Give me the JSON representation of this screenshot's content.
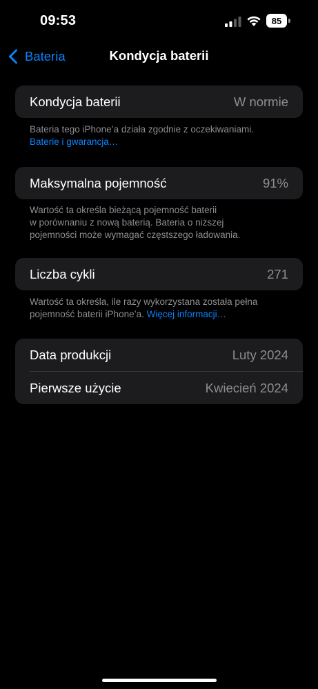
{
  "status_bar": {
    "time": "09:53",
    "battery_level": "85"
  },
  "nav": {
    "back_label": "Bateria",
    "title": "Kondycja baterii"
  },
  "health": {
    "label": "Kondycja baterii",
    "value": "W normie",
    "footnote": "Bateria tego iPhone’a działa zgodnie z oczekiwaniami.",
    "link": "Baterie i gwarancja…"
  },
  "capacity": {
    "label": "Maksymalna pojemność",
    "value": "91%",
    "footnote_line1": "Wartość ta określa bieżącą pojemność baterii",
    "footnote_line2": "w porównaniu z nową baterią. Bateria o niższej",
    "footnote_line3": "pojemności może wymagać częstszego ładowania."
  },
  "cycles": {
    "label": "Liczba cykli",
    "value": "271",
    "footnote_line1": "Wartość ta określa, ile razy wykorzystana została pełna",
    "footnote_line2": "pojemność baterii iPhone’a.",
    "link": "Więcej informacji…"
  },
  "dates": {
    "manufacture_label": "Data produkcji",
    "manufacture_value": "Luty 2024",
    "first_use_label": "Pierwsze użycie",
    "first_use_value": "Kwiecień 2024"
  },
  "colors": {
    "accent": "#0a84ff",
    "background": "#000000",
    "cell": "#1c1c1e",
    "secondary_text": "#8e8e93"
  }
}
